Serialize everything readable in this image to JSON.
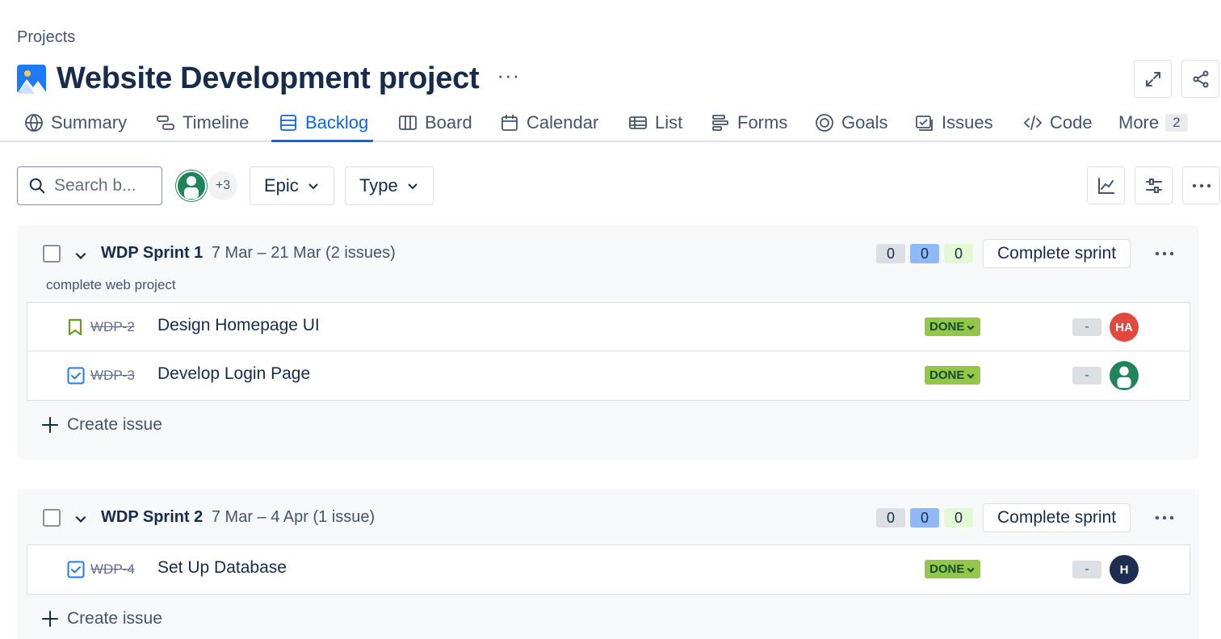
{
  "breadcrumb": "Projects",
  "project": {
    "title": "Website Development project",
    "more_label": "···"
  },
  "tabs": [
    {
      "label": "Summary",
      "icon": "globe-icon",
      "active": false
    },
    {
      "label": "Timeline",
      "icon": "timeline-icon",
      "active": false
    },
    {
      "label": "Backlog",
      "icon": "backlog-icon",
      "active": true
    },
    {
      "label": "Board",
      "icon": "board-icon",
      "active": false
    },
    {
      "label": "Calendar",
      "icon": "calendar-icon",
      "active": false
    },
    {
      "label": "List",
      "icon": "list-icon",
      "active": false
    },
    {
      "label": "Forms",
      "icon": "forms-icon",
      "active": false
    },
    {
      "label": "Goals",
      "icon": "goals-icon",
      "active": false
    },
    {
      "label": "Issues",
      "icon": "issues-icon",
      "active": false
    },
    {
      "label": "Code",
      "icon": "code-icon",
      "active": false
    },
    {
      "label": "More",
      "count": "2"
    }
  ],
  "toolbar": {
    "search_placeholder": "Search b...",
    "avatar_more": "+3",
    "epic_label": "Epic",
    "type_label": "Type"
  },
  "colors": {
    "accent": "#0c66e4",
    "status_done": "#94c748",
    "avatar_green": "#1f845a",
    "avatar_orange": "#e2483d",
    "avatar_navy": "#1d2d50"
  },
  "sprints": [
    {
      "name": "WDP Sprint 1",
      "dates": "7 Mar – 21 Mar (2 issues)",
      "goal": "complete web project",
      "counts": {
        "todo": "0",
        "in_progress": "0",
        "done": "0"
      },
      "complete_label": "Complete sprint",
      "issues": [
        {
          "type": "story",
          "key": "WDP-2",
          "summary": "Design Homepage UI",
          "status": "DONE",
          "estimate": "-",
          "assignee": "HA"
        },
        {
          "type": "task",
          "key": "WDP-3",
          "summary": "Develop Login Page",
          "status": "DONE",
          "estimate": "-",
          "assignee": ""
        }
      ],
      "create_label": "Create issue"
    },
    {
      "name": "WDP Sprint 2",
      "dates": "7 Mar – 4 Apr (1 issue)",
      "counts": {
        "todo": "0",
        "in_progress": "0",
        "done": "0"
      },
      "complete_label": "Complete sprint",
      "issues": [
        {
          "type": "task",
          "key": "WDP-4",
          "summary": "Set Up Database",
          "status": "DONE",
          "estimate": "-",
          "assignee": "H"
        }
      ],
      "create_label": "Create issue"
    }
  ]
}
